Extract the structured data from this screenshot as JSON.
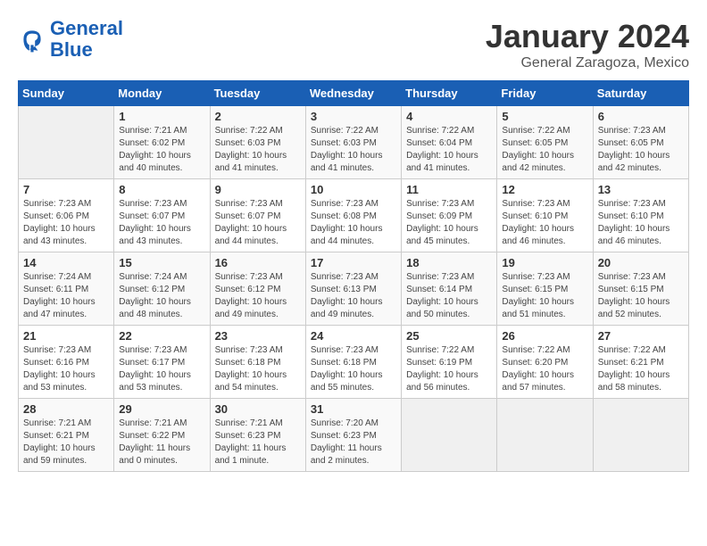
{
  "header": {
    "logo_line1": "General",
    "logo_line2": "Blue",
    "month_title": "January 2024",
    "subtitle": "General Zaragoza, Mexico"
  },
  "days_of_week": [
    "Sunday",
    "Monday",
    "Tuesday",
    "Wednesday",
    "Thursday",
    "Friday",
    "Saturday"
  ],
  "weeks": [
    [
      {
        "day": "",
        "info": ""
      },
      {
        "day": "1",
        "info": "Sunrise: 7:21 AM\nSunset: 6:02 PM\nDaylight: 10 hours\nand 40 minutes."
      },
      {
        "day": "2",
        "info": "Sunrise: 7:22 AM\nSunset: 6:03 PM\nDaylight: 10 hours\nand 41 minutes."
      },
      {
        "day": "3",
        "info": "Sunrise: 7:22 AM\nSunset: 6:03 PM\nDaylight: 10 hours\nand 41 minutes."
      },
      {
        "day": "4",
        "info": "Sunrise: 7:22 AM\nSunset: 6:04 PM\nDaylight: 10 hours\nand 41 minutes."
      },
      {
        "day": "5",
        "info": "Sunrise: 7:22 AM\nSunset: 6:05 PM\nDaylight: 10 hours\nand 42 minutes."
      },
      {
        "day": "6",
        "info": "Sunrise: 7:23 AM\nSunset: 6:05 PM\nDaylight: 10 hours\nand 42 minutes."
      }
    ],
    [
      {
        "day": "7",
        "info": "Sunrise: 7:23 AM\nSunset: 6:06 PM\nDaylight: 10 hours\nand 43 minutes."
      },
      {
        "day": "8",
        "info": "Sunrise: 7:23 AM\nSunset: 6:07 PM\nDaylight: 10 hours\nand 43 minutes."
      },
      {
        "day": "9",
        "info": "Sunrise: 7:23 AM\nSunset: 6:07 PM\nDaylight: 10 hours\nand 44 minutes."
      },
      {
        "day": "10",
        "info": "Sunrise: 7:23 AM\nSunset: 6:08 PM\nDaylight: 10 hours\nand 44 minutes."
      },
      {
        "day": "11",
        "info": "Sunrise: 7:23 AM\nSunset: 6:09 PM\nDaylight: 10 hours\nand 45 minutes."
      },
      {
        "day": "12",
        "info": "Sunrise: 7:23 AM\nSunset: 6:10 PM\nDaylight: 10 hours\nand 46 minutes."
      },
      {
        "day": "13",
        "info": "Sunrise: 7:23 AM\nSunset: 6:10 PM\nDaylight: 10 hours\nand 46 minutes."
      }
    ],
    [
      {
        "day": "14",
        "info": "Sunrise: 7:24 AM\nSunset: 6:11 PM\nDaylight: 10 hours\nand 47 minutes."
      },
      {
        "day": "15",
        "info": "Sunrise: 7:24 AM\nSunset: 6:12 PM\nDaylight: 10 hours\nand 48 minutes."
      },
      {
        "day": "16",
        "info": "Sunrise: 7:23 AM\nSunset: 6:12 PM\nDaylight: 10 hours\nand 49 minutes."
      },
      {
        "day": "17",
        "info": "Sunrise: 7:23 AM\nSunset: 6:13 PM\nDaylight: 10 hours\nand 49 minutes."
      },
      {
        "day": "18",
        "info": "Sunrise: 7:23 AM\nSunset: 6:14 PM\nDaylight: 10 hours\nand 50 minutes."
      },
      {
        "day": "19",
        "info": "Sunrise: 7:23 AM\nSunset: 6:15 PM\nDaylight: 10 hours\nand 51 minutes."
      },
      {
        "day": "20",
        "info": "Sunrise: 7:23 AM\nSunset: 6:15 PM\nDaylight: 10 hours\nand 52 minutes."
      }
    ],
    [
      {
        "day": "21",
        "info": "Sunrise: 7:23 AM\nSunset: 6:16 PM\nDaylight: 10 hours\nand 53 minutes."
      },
      {
        "day": "22",
        "info": "Sunrise: 7:23 AM\nSunset: 6:17 PM\nDaylight: 10 hours\nand 53 minutes."
      },
      {
        "day": "23",
        "info": "Sunrise: 7:23 AM\nSunset: 6:18 PM\nDaylight: 10 hours\nand 54 minutes."
      },
      {
        "day": "24",
        "info": "Sunrise: 7:23 AM\nSunset: 6:18 PM\nDaylight: 10 hours\nand 55 minutes."
      },
      {
        "day": "25",
        "info": "Sunrise: 7:22 AM\nSunset: 6:19 PM\nDaylight: 10 hours\nand 56 minutes."
      },
      {
        "day": "26",
        "info": "Sunrise: 7:22 AM\nSunset: 6:20 PM\nDaylight: 10 hours\nand 57 minutes."
      },
      {
        "day": "27",
        "info": "Sunrise: 7:22 AM\nSunset: 6:21 PM\nDaylight: 10 hours\nand 58 minutes."
      }
    ],
    [
      {
        "day": "28",
        "info": "Sunrise: 7:21 AM\nSunset: 6:21 PM\nDaylight: 10 hours\nand 59 minutes."
      },
      {
        "day": "29",
        "info": "Sunrise: 7:21 AM\nSunset: 6:22 PM\nDaylight: 11 hours\nand 0 minutes."
      },
      {
        "day": "30",
        "info": "Sunrise: 7:21 AM\nSunset: 6:23 PM\nDaylight: 11 hours\nand 1 minute."
      },
      {
        "day": "31",
        "info": "Sunrise: 7:20 AM\nSunset: 6:23 PM\nDaylight: 11 hours\nand 2 minutes."
      },
      {
        "day": "",
        "info": ""
      },
      {
        "day": "",
        "info": ""
      },
      {
        "day": "",
        "info": ""
      }
    ]
  ]
}
